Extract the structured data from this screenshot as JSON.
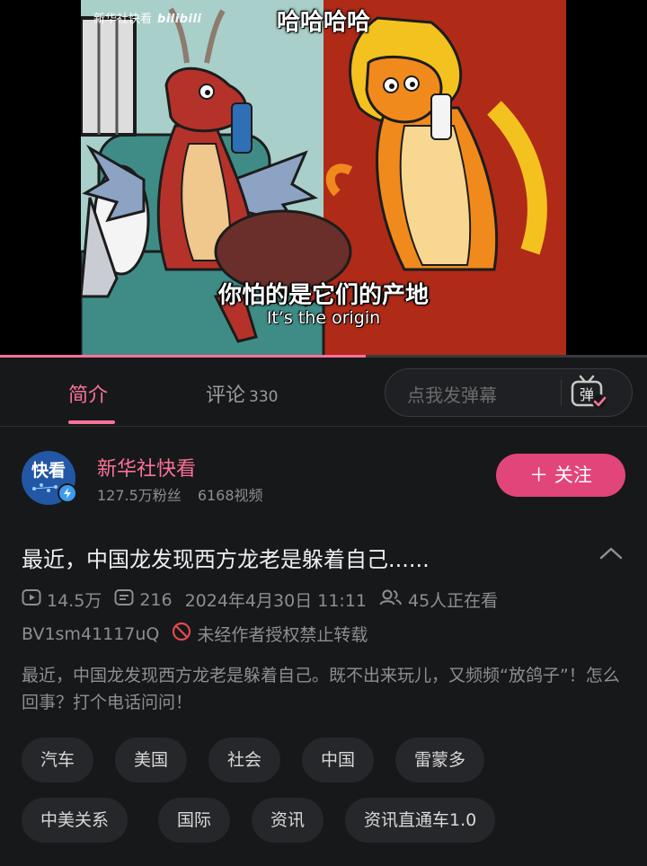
{
  "video": {
    "watermark_brand": "新华社快看",
    "watermark_site": "bilibili",
    "overlay_top": "哈哈哈哈",
    "subtitle_cn": "你怕的是它们的产地",
    "subtitle_en": "It’s the origin",
    "progress_fraction": 0.565
  },
  "tabs": {
    "intro_label": "简介",
    "comments_label": "评论",
    "comments_count": "330",
    "danmaku_placeholder": "点我发弹幕",
    "danmaku_icon_char": "弹"
  },
  "uploader": {
    "avatar_text": "快看",
    "name": "新华社快看",
    "fans": "127.5万粉丝",
    "videos": "6168视频",
    "follow_label": "＋ 关注"
  },
  "video_info": {
    "title": "最近，中国龙发现西方龙老是躲着自己......",
    "plays": "14.5万",
    "danmaku_count": "216",
    "date": "2024年4月30日 11:11",
    "watching": "45人正在看",
    "bvid": "BV1sm41117uQ",
    "copyright": "未经作者授权禁止转载",
    "description": "最近，中国龙发现西方龙老是躲着自己。既不出来玩儿，又频频“放鸽子”！怎么回事？打个电话问问！"
  },
  "tags": [
    "汽车",
    "美国",
    "社会",
    "中国",
    "雷蒙多",
    "中美关系",
    "国际",
    "资讯",
    "资讯直通车1.0"
  ],
  "colors": {
    "accent": "#fb7299",
    "follow_bg": "#e2457a",
    "background": "#17181a",
    "warning": "#e24a4a"
  }
}
